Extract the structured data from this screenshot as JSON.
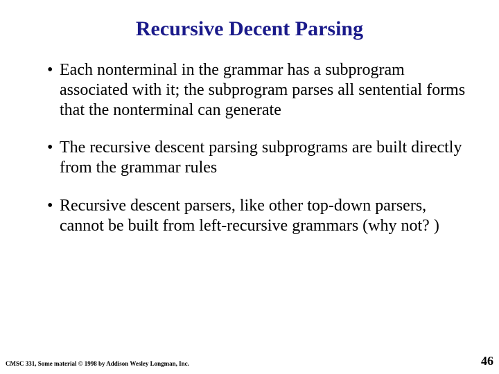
{
  "title": "Recursive Decent Parsing",
  "bullets": [
    "Each nonterminal in the grammar has a subprogram associated with it; the subprogram parses all sentential forms that the nonterminal can generate",
    "The recursive descent parsing subprograms are built directly from the grammar rules",
    "Recursive descent parsers, like other top-down parsers, cannot be built from left-recursive grammars (why not? )"
  ],
  "footer": {
    "left": "CMSC 331, Some material © 1998 by Addison Wesley Longman, Inc.",
    "right": "46"
  }
}
